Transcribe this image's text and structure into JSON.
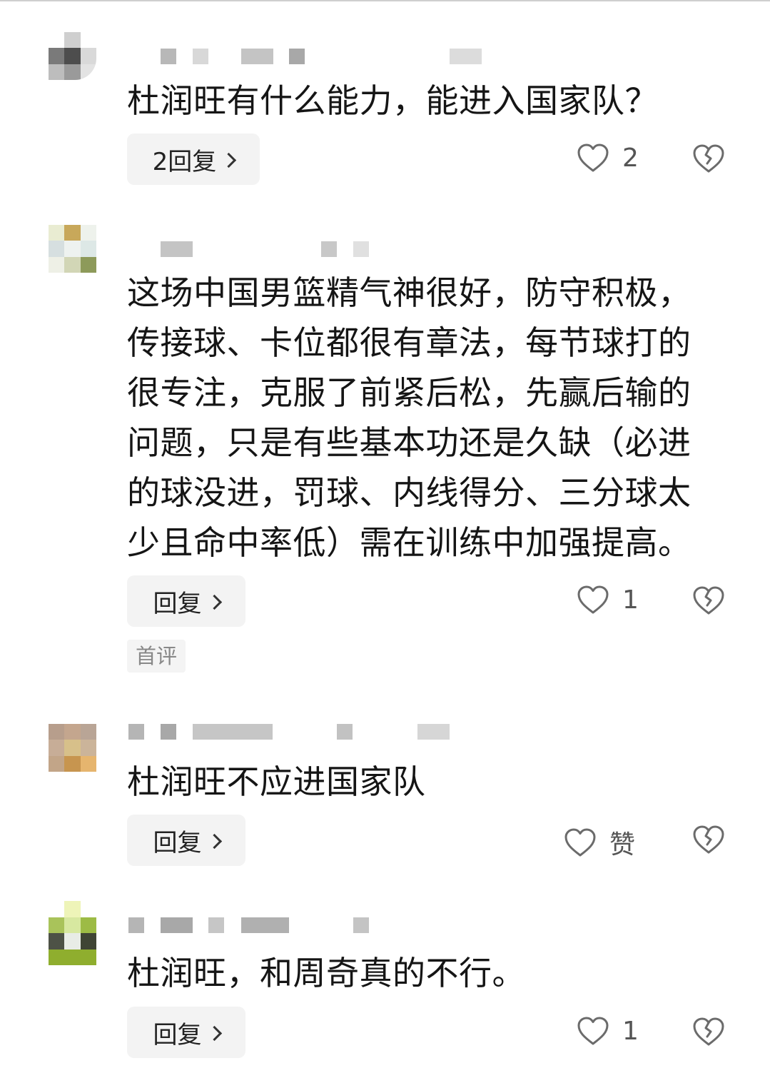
{
  "comments": [
    {
      "text": "杜润旺有什么能力，能进入国家队？",
      "reply_label": "2回复",
      "like_count": "2",
      "avatar_colors": [
        "#ffffff",
        "#cfcfcf",
        "#ffffff",
        "#7a7a7a",
        "#4d4d4d",
        "#d9d9d9",
        "#bdbdbd",
        "#9a9a9a",
        "#c8c8c8"
      ]
    },
    {
      "text": "这场中国男篮精气神很好，防守积极，传接球、卡位都很有章法，每节球打的很专注，克服了前紧后松，先赢后输的问题，只是有些基本功还是久缺（必进的球没进，罚球、内线得分、三分球太少且命中率低）需在训练中加强提高。",
      "reply_label": "回复",
      "like_count": "1",
      "badge": "首评",
      "avatar_colors": [
        "#e9ecd2",
        "#c8a85a",
        "#eef2ec",
        "#d6dfe0",
        "#eef2f0",
        "#dde8e6",
        "#eef0e6",
        "#9aa36c",
        "#6e7a3e"
      ]
    },
    {
      "text": "杜润旺不应进国家队",
      "reply_label": "回复",
      "like_count": "赞",
      "avatar_colors": [
        "#b79e8c",
        "#c4a68e",
        "#b9a596",
        "#c7ad97",
        "#d7c08a",
        "#cbb49a",
        "#c2a588",
        "#c7954f",
        "#e6b56e"
      ]
    },
    {
      "text": "杜润旺，和周奇真的不行。",
      "reply_label": "回复",
      "like_count": "1",
      "avatar_colors": [
        "#ffffff",
        "#eaf0b0",
        "#ffffff",
        "#a9c35a",
        "#d7e8a0",
        "#9dbb45",
        "#555a48",
        "#e8ece6",
        "#4a4f3c"
      ]
    }
  ]
}
